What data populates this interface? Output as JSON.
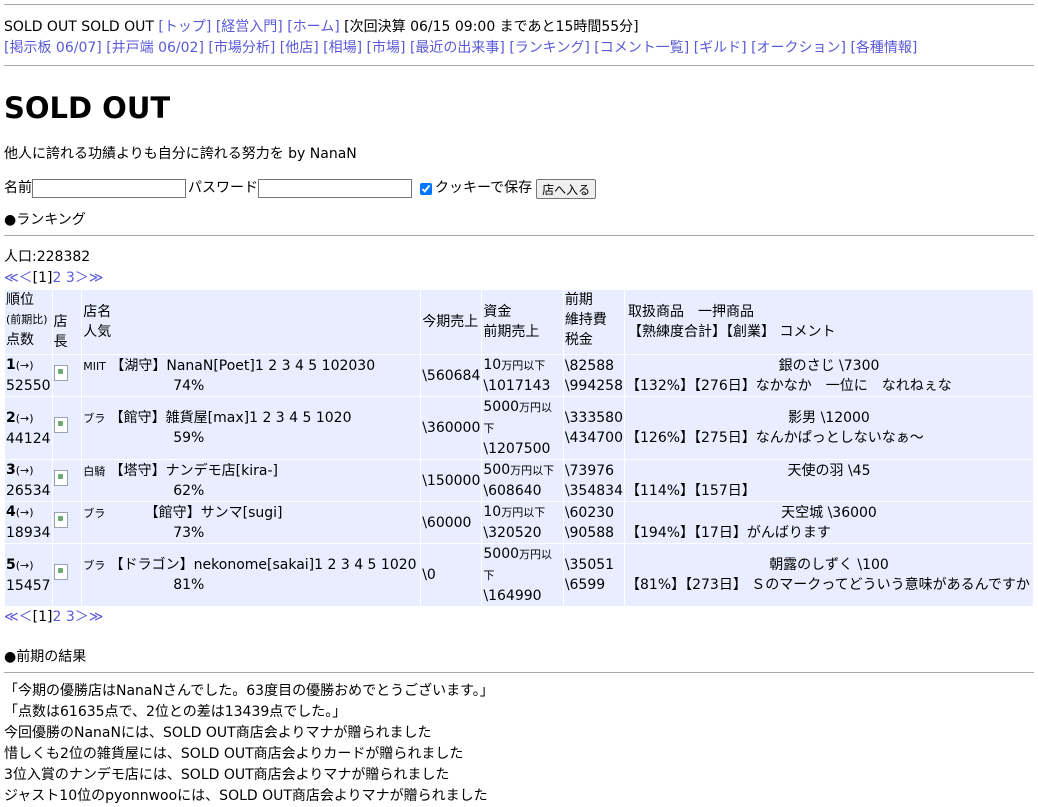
{
  "header": {
    "site_title": "SOLD OUT SOLD OUT",
    "links_row1": [
      "[トップ]",
      "[経営入門]",
      "[ホーム]"
    ],
    "next_settlement": "[次回決算 06/15 09:00 まであと15時間55分]",
    "links_row2": [
      "[掲示板 06/07]",
      "[井戸端 06/02]",
      "[市場分析]",
      "[他店]",
      "[相場]",
      "[市場]",
      "[最近の出来事]",
      "[ランキング]",
      "[コメント一覧]",
      "[ギルド]",
      "[オークション]",
      "[各種情報]"
    ]
  },
  "page_title": "SOLD OUT",
  "tagline": "他人に誇れる功績よりも自分に誇れる努力を by NanaN",
  "login": {
    "name_label": "名前",
    "password_label": "パスワード",
    "cookie_label": "クッキーで保存",
    "enter_button": "店へ入る"
  },
  "ranking": {
    "heading": "●ランキング",
    "population": "人口:228382",
    "pager": {
      "first": "≪",
      "prev": "＜",
      "current": "[1]",
      "p2": "2",
      "p3": "3",
      "next": "＞",
      "last": "≫"
    },
    "headers": {
      "rank": "順位",
      "rank_sub": "(前期比)",
      "points": "点数",
      "owner": "店長",
      "shop": "店名",
      "popularity": "人気",
      "sales": "今期売上",
      "funds": "資金",
      "prev_sales": "前期売上",
      "maint": "前期",
      "maint2": "維持費",
      "tax": "税金",
      "goods": "取扱商品　一押商品",
      "goods2": "【熟練度合計】【創業】 コメント"
    },
    "rows": [
      {
        "rank": "1",
        "change": "(→)",
        "points": "52550",
        "tag": "MIIT",
        "shop": "【湖守】NanaN[Poet]1 2 3 4 5 102030",
        "pop": "74%",
        "sales": "\\560684",
        "funds_num": "10",
        "funds_unit": "万円以下",
        "prev_sales": "\\1017143",
        "maint": "\\82588",
        "tax": "\\994258",
        "item": "銀のさじ \\7300",
        "comment": "【132%】【276日】なかなか　一位に　なれねぇな"
      },
      {
        "rank": "2",
        "change": "(→)",
        "points": "44124",
        "tag": "ブラ",
        "shop": "【館守】雑貨屋[max]1 2 3 4 5 1020",
        "pop": "59%",
        "sales": "\\360000",
        "funds_num": "5000",
        "funds_unit": "万円以下",
        "prev_sales": "\\1207500",
        "maint": "\\333580",
        "tax": "\\434700",
        "item": "影男 \\12000",
        "comment": "【126%】【275日】なんかぱっとしないなぁ〜"
      },
      {
        "rank": "3",
        "change": "(→)",
        "points": "26534",
        "tag": "白騎",
        "shop": "【塔守】ナンデモ店[kira-]",
        "pop": "62%",
        "sales": "\\150000",
        "funds_num": "500",
        "funds_unit": "万円以下",
        "prev_sales": "\\608640",
        "maint": "\\73976",
        "tax": "\\354834",
        "item": "天使の羽 \\45",
        "comment": "【114%】【157日】"
      },
      {
        "rank": "4",
        "change": "(→)",
        "points": "18934",
        "tag": "ブラ",
        "shop": "　　　【館守】サンマ[sugi]",
        "pop": "73%",
        "sales": "\\60000",
        "funds_num": "10",
        "funds_unit": "万円以下",
        "prev_sales": "\\320520",
        "maint": "\\60230",
        "tax": "\\90588",
        "item": "天空城 \\36000",
        "comment": "【194%】【17日】がんばります"
      },
      {
        "rank": "5",
        "change": "(→)",
        "points": "15457",
        "tag": "ブラ",
        "shop": "【ドラゴン】nekonome[sakai]1 2 3 4 5 1020",
        "pop": "81%",
        "sales": "\\0",
        "funds_num": "5000",
        "funds_unit": "万円以下",
        "prev_sales": "\\164990",
        "maint": "\\35051",
        "tax": "\\6599",
        "item": "朝露のしずく \\100",
        "comment": "【81%】【273日】 Ｓのマークってどういう意味があるんですか"
      }
    ]
  },
  "results": {
    "heading": "●前期の結果",
    "lines": [
      "「今期の優勝店はNanaNさんでした。63度目の優勝おめでとうございます。」",
      "「点数は61635点で、2位との差は13439点でした。」",
      "今回優勝のNanaNには、SOLD OUT商店会よりマナが贈られました",
      "惜しくも2位の雑貨屋には、SOLD OUT商店会よりカードが贈られました",
      "3位入賞のナンデモ店には、SOLD OUT商店会よりマナが贈られました",
      "ジャスト10位のpyonnwooには、SOLD OUT商店会よりマナが贈られました"
    ]
  }
}
